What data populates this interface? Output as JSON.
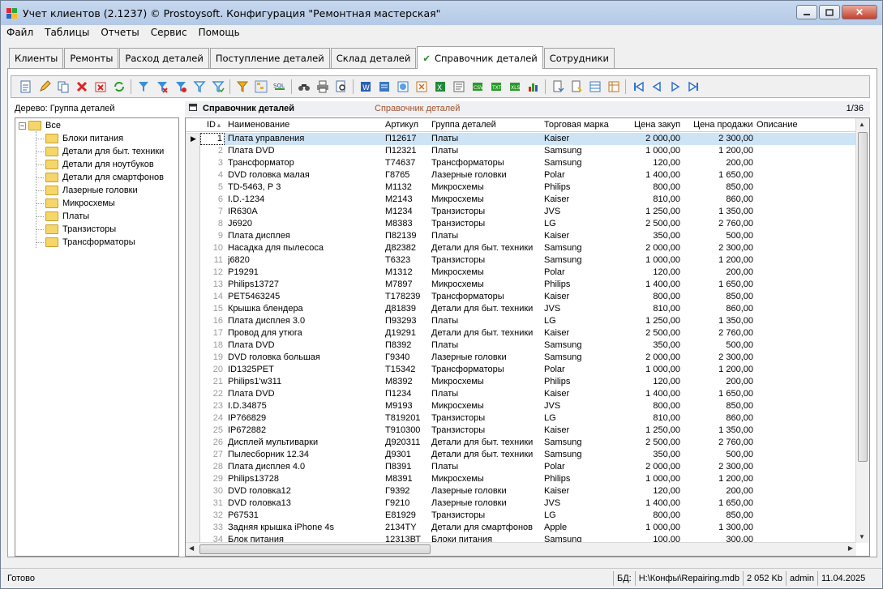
{
  "window": {
    "title": "Учет клиентов (2.1237) © Prostoysoft. Конфигурация \"Ремонтная мастерская\""
  },
  "menu": [
    "Файл",
    "Таблицы",
    "Отчеты",
    "Сервис",
    "Помощь"
  ],
  "tabs": [
    "Клиенты",
    "Ремонты",
    "Расход деталей",
    "Поступление деталей",
    "Склад деталей",
    "Справочник деталей",
    "Сотрудники"
  ],
  "active_tab": "Справочник деталей",
  "tree": {
    "caption": "Дерево: Группа деталей",
    "root": "Все",
    "items": [
      "Блоки питания",
      "Детали для быт. техники",
      "Детали для ноутбуков",
      "Детали для смартфонов",
      "Лазерные головки",
      "Микросхемы",
      "Платы",
      "Транзисторы",
      "Трансформаторы"
    ]
  },
  "grid": {
    "title": "Справочник деталей",
    "subtitle": "Справочник деталей",
    "counter": "1/36",
    "columns": [
      "ID",
      "Наименование",
      "Артикул",
      "Группа деталей",
      "Торговая марка",
      "Цена закуп",
      "Цена продажи",
      "Описание"
    ],
    "rows": [
      [
        "1",
        "Плата управления",
        "П12617",
        "Платы",
        "Kaiser",
        "2 000,00",
        "2 300,00"
      ],
      [
        "2",
        "Плата DVD",
        "П12321",
        "Платы",
        "Samsung",
        "1 000,00",
        "1 200,00"
      ],
      [
        "3",
        "Трансформатор",
        "Т74637",
        "Трансформаторы",
        "Samsung",
        "120,00",
        "200,00"
      ],
      [
        "4",
        "DVD головка малая",
        "Г8765",
        "Лазерные головки",
        "Polar",
        "1 400,00",
        "1 650,00"
      ],
      [
        "5",
        "TD-5463, Р 3",
        "М1132",
        "Микросхемы",
        "Philips",
        "800,00",
        "850,00"
      ],
      [
        "6",
        "I.D.-1234",
        "М2143",
        "Микросхемы",
        "Kaiser",
        "810,00",
        "860,00"
      ],
      [
        "7",
        "IR630A",
        "М1234",
        "Транзисторы",
        "JVS",
        "1 250,00",
        "1 350,00"
      ],
      [
        "8",
        "J6920",
        "М8383",
        "Транзисторы",
        "LG",
        "2 500,00",
        "2 760,00"
      ],
      [
        "9",
        "Плата дисплея",
        "П82139",
        "Платы",
        "Kaiser",
        "350,00",
        "500,00"
      ],
      [
        "10",
        "Насадка для пылесоса",
        "Д82382",
        "Детали для быт. техники",
        "Samsung",
        "2 000,00",
        "2 300,00"
      ],
      [
        "11",
        "j6820",
        "Т6323",
        "Транзисторы",
        "Samsung",
        "1 000,00",
        "1 200,00"
      ],
      [
        "12",
        "P19291",
        "М1312",
        "Микросхемы",
        "Polar",
        "120,00",
        "200,00"
      ],
      [
        "13",
        "Philips13727",
        "М7897",
        "Микросхемы",
        "Philips",
        "1 400,00",
        "1 650,00"
      ],
      [
        "14",
        "PET5463245",
        "Т178239",
        "Трансформаторы",
        "Kaiser",
        "800,00",
        "850,00"
      ],
      [
        "15",
        "Крышка блендера",
        "Д81839",
        "Детали для быт. техники",
        "JVS",
        "810,00",
        "860,00"
      ],
      [
        "16",
        "Плата дисплея 3.0",
        "П93293",
        "Платы",
        "LG",
        "1 250,00",
        "1 350,00"
      ],
      [
        "17",
        "Провод для утюга",
        "Д19291",
        "Детали для быт. техники",
        "Kaiser",
        "2 500,00",
        "2 760,00"
      ],
      [
        "18",
        "Плата DVD",
        "П8392",
        "Платы",
        "Samsung",
        "350,00",
        "500,00"
      ],
      [
        "19",
        "DVD головка большая",
        "Г9340",
        "Лазерные головки",
        "Samsung",
        "2 000,00",
        "2 300,00"
      ],
      [
        "20",
        "ID1325PET",
        "Т15342",
        "Трансформаторы",
        "Polar",
        "1 000,00",
        "1 200,00"
      ],
      [
        "21",
        "Philips1'w311",
        "М8392",
        "Микросхемы",
        "Philips",
        "120,00",
        "200,00"
      ],
      [
        "22",
        "Плата DVD",
        "П1234",
        "Платы",
        "Kaiser",
        "1 400,00",
        "1 650,00"
      ],
      [
        "23",
        "I.D.34875",
        "М9193",
        "Микросхемы",
        "JVS",
        "800,00",
        "850,00"
      ],
      [
        "24",
        "IP766829",
        "Т819201",
        "Транзисторы",
        "LG",
        "810,00",
        "860,00"
      ],
      [
        "25",
        "IP672882",
        "Т910300",
        "Транзисторы",
        "Kaiser",
        "1 250,00",
        "1 350,00"
      ],
      [
        "26",
        "Дисплей мультиварки",
        "Д920311",
        "Детали для быт. техники",
        "Samsung",
        "2 500,00",
        "2 760,00"
      ],
      [
        "27",
        "Пылесборник 12.34",
        "Д9301",
        "Детали для быт. техники",
        "Samsung",
        "350,00",
        "500,00"
      ],
      [
        "28",
        "Плата дисплея 4.0",
        "П8391",
        "Платы",
        "Polar",
        "2 000,00",
        "2 300,00"
      ],
      [
        "29",
        "Philips13728",
        "М8391",
        "Микросхемы",
        "Philips",
        "1 000,00",
        "1 200,00"
      ],
      [
        "30",
        "DVD головка12",
        "Г9392",
        "Лазерные головки",
        "Kaiser",
        "120,00",
        "200,00"
      ],
      [
        "31",
        "DVD головка13",
        "Г9210",
        "Лазерные головки",
        "JVS",
        "1 400,00",
        "1 650,00"
      ],
      [
        "32",
        "P67531",
        "Е81929",
        "Транзисторы",
        "LG",
        "800,00",
        "850,00"
      ],
      [
        "33",
        "Задняя крышка iPhone 4s",
        "2134TY",
        "Детали для смартфонов",
        "Apple",
        "1 000,00",
        "1 300,00"
      ],
      [
        "34",
        "Блок питания",
        "12313ВТ",
        "Блоки питания",
        "Samsung",
        "100,00",
        "300,00"
      ]
    ]
  },
  "status": {
    "left": "Готово",
    "db_label": "БД:",
    "db_path": "H:\\Конфы\\Repairing.mdb",
    "size": "2 052 Kb",
    "user": "admin",
    "date": "11.04.2025"
  }
}
